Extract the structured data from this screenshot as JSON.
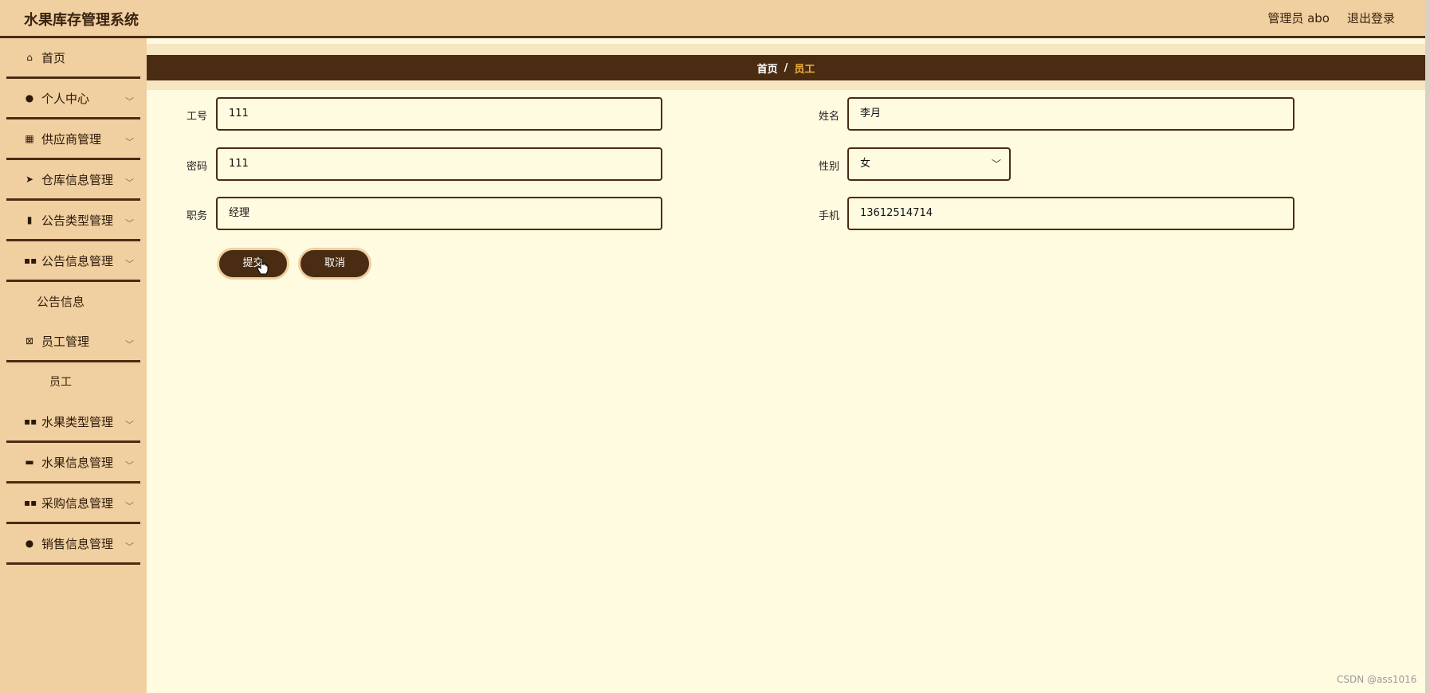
{
  "header": {
    "app_title": "水果库存管理系统",
    "user_label": "管理员 abo",
    "logout_label": "退出登录"
  },
  "sidebar": {
    "items": [
      {
        "label": "首页",
        "icon": "home-icon"
      },
      {
        "label": "个人中心",
        "icon": "user-icon"
      },
      {
        "label": "供应商管理",
        "icon": "grid-icon"
      },
      {
        "label": "仓库信息管理",
        "icon": "send-icon"
      },
      {
        "label": "公告类型管理",
        "icon": "clipboard-icon"
      },
      {
        "label": "公告信息管理",
        "icon": "apps-icon"
      },
      {
        "label": "员工管理",
        "icon": "clipboard-x-icon"
      },
      {
        "label": "水果类型管理",
        "icon": "apps-icon"
      },
      {
        "label": "水果信息管理",
        "icon": "ticket-icon"
      },
      {
        "label": "采购信息管理",
        "icon": "apps-icon"
      },
      {
        "label": "销售信息管理",
        "icon": "user-icon"
      }
    ],
    "sub_notice": "公告信息",
    "sub_employee": "员工"
  },
  "breadcrumb": {
    "home": "首页",
    "separator": "/",
    "current": "员工"
  },
  "form": {
    "gonghao": {
      "label": "工号",
      "value": "111"
    },
    "mima": {
      "label": "密码",
      "value": "111"
    },
    "zhiwu": {
      "label": "职务",
      "value": "经理"
    },
    "xingming": {
      "label": "姓名",
      "value": "李月"
    },
    "xingbie": {
      "label": "性别",
      "value": "女"
    },
    "shouji": {
      "label": "手机",
      "value": "13612514714"
    },
    "submit_label": "提交",
    "cancel_label": "取消"
  },
  "watermark": "CSDN @ass1016"
}
